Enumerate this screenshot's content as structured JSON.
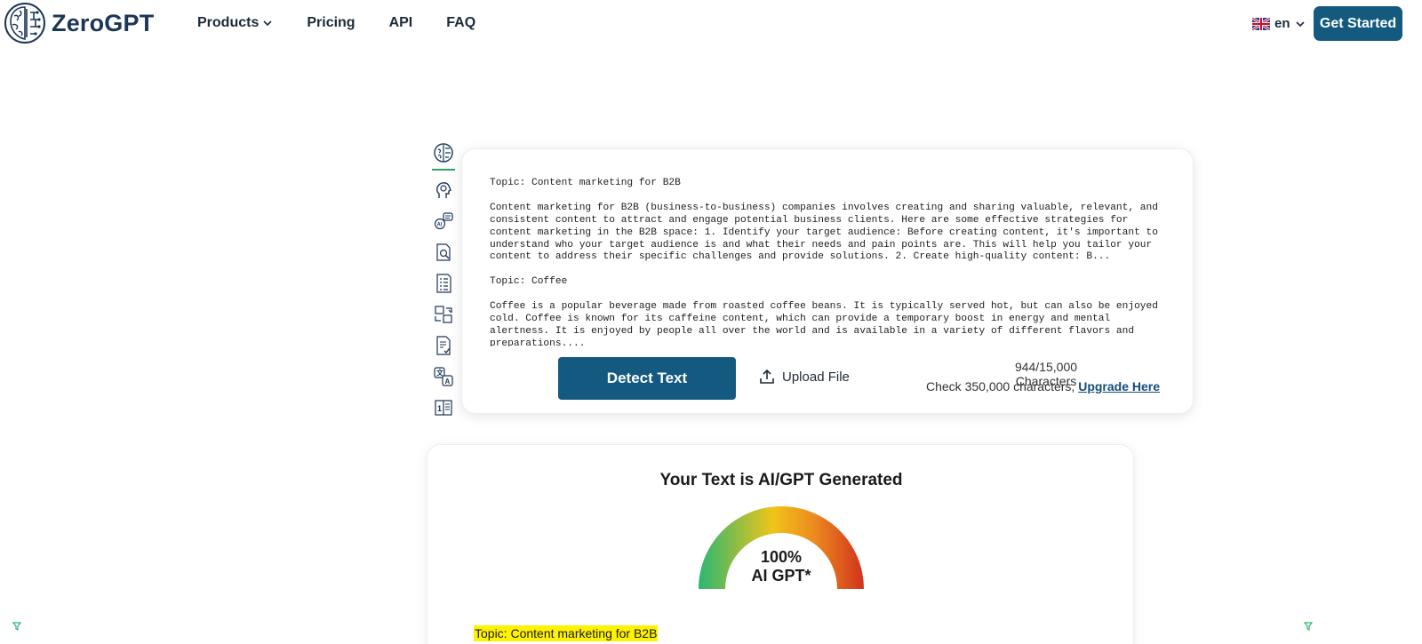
{
  "brand": {
    "name": "ZeroGPT"
  },
  "nav": {
    "items": [
      {
        "label": "Products",
        "has_dropdown": true
      },
      {
        "label": "Pricing"
      },
      {
        "label": "API"
      },
      {
        "label": "FAQ"
      }
    ]
  },
  "language": {
    "code": "en",
    "flag": "uk-flag-icon"
  },
  "header": {
    "cta_label": "Get Started"
  },
  "tools": [
    "brain-icon",
    "head-ai-icon",
    "ai-chat-icon",
    "document-search-icon",
    "document-list-icon",
    "paraphrase-icon",
    "document-check-icon",
    "translate-icon",
    "word-counter-icon"
  ],
  "input": {
    "paragraphs": [
      "Topic: Content marketing for B2B",
      "Content marketing for B2B (business-to-business) companies involves creating and sharing valuable, relevant, and consistent content to attract and engage potential business clients. Here are some effective strategies for content marketing in the B2B space: 1. Identify your target audience: Before creating content, it's important to understand who your target audience is and what their needs and pain points are. This will help you tailor your content to address their specific challenges and provide solutions. 2. Create high-quality content: B...",
      "Topic: Coffee",
      "Coffee is a popular beverage made from roasted coffee beans. It is typically served hot, but can also be enjoyed cold. Coffee is known for its caffeine content, which can provide a temporary boost in energy and mental alertness. It is enjoyed by people all over the world and is available in a variety of different flavors and preparations...."
    ],
    "detect_label": "Detect Text",
    "upload_label": "Upload File",
    "char_count": "944/15,000 Characters",
    "upgrade_prefix": "Check 350,000 characters, ",
    "upgrade_link": "Upgrade Here"
  },
  "result": {
    "title": "Your Text is AI/GPT Generated",
    "gauge_value": 1.0,
    "gauge_percent": "100%",
    "gauge_label": "AI GPT*",
    "highlighted_text": "Topic: Content marketing for B2B",
    "colors": {
      "low": "#2bb673",
      "mid": "#f0c419",
      "high": "#d9381e",
      "highlight": "#fff200"
    }
  },
  "colors": {
    "primary": "#145a80",
    "brand_text": "#1c3657"
  }
}
